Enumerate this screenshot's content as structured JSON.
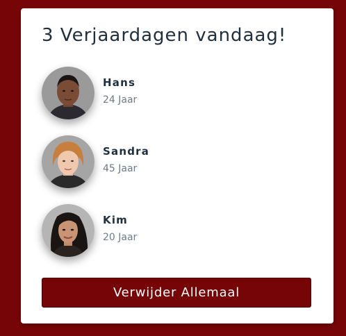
{
  "card": {
    "title": "3 Verjaardagen vandaag!",
    "people": [
      {
        "name": "Hans",
        "age": "24 Jaar",
        "avatar_icon": "person-photo-hans"
      },
      {
        "name": "Sandra",
        "age": "45 Jaar",
        "avatar_icon": "person-photo-sandra"
      },
      {
        "name": "Kim",
        "age": "20 Jaar",
        "avatar_icon": "person-photo-kim"
      }
    ],
    "clear_button_label": "Verwijder Allemaal"
  },
  "colors": {
    "background": "#760507",
    "button": "#760507",
    "text": "#1f2f3d",
    "muted_text": "#6b7b8a"
  }
}
